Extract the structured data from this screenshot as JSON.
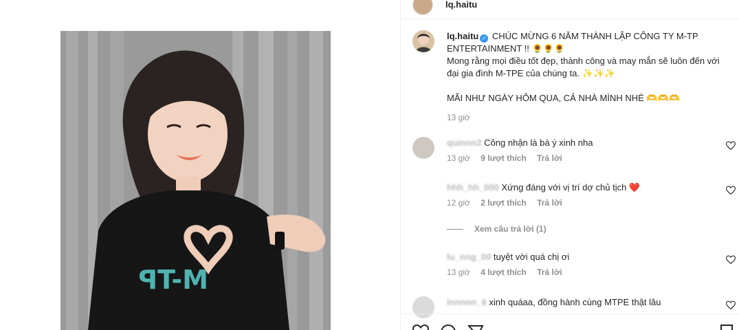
{
  "header": {
    "username": "lq.haitu"
  },
  "caption": {
    "username": "lq.haitu",
    "line1": "CHÚC MỪNG 6 NĂM THÀNH LẬP CÔNG TY M-TP ENTERTAINMENT !! 🌻🌻🌻",
    "line2": "Mong rằng mọi điều tốt đẹp, thành công và may mắn sẽ luôn đến với đại gia đình M-TPE của chúng ta. ✨✨✨",
    "line3": "MÃI NHƯ NGÀY HÔM QUA, CẢ NHÀ MÌNH NHÉ 🫶🫶🫶",
    "time": "13 giờ"
  },
  "comments": [
    {
      "user": "quinnn2",
      "text": "Công nhận là bà ý xinh nha",
      "time": "13 giờ",
      "likes": "9 lượt thích",
      "reply": "Trả lời"
    },
    {
      "user": "hhh_hh_000",
      "text": "Xứng đáng với vị trí dợ chủ tịch ❤️",
      "time": "12 giờ",
      "likes": "2 lượt thích",
      "reply": "Trả lời"
    },
    {
      "user": "lu_nng_00",
      "text": "tuyệt vời quá chị ơi",
      "time": "13 giờ",
      "likes": "4 lượt thích",
      "reply": "Trả lời"
    },
    {
      "user": "lnnnnn_6",
      "text": "xinh quáaa, đồng hành cùng MTPE thật lâu",
      "time": "",
      "likes": "",
      "reply": ""
    }
  ],
  "view_replies": "Xem câu trả lời (1)",
  "icons": [
    "verified-icon",
    "heart-icon",
    "comment-icon",
    "share-icon",
    "save-icon"
  ],
  "colors": {
    "verified": "#3897f0",
    "muted": "#8e8e8e",
    "text": "#262626"
  }
}
